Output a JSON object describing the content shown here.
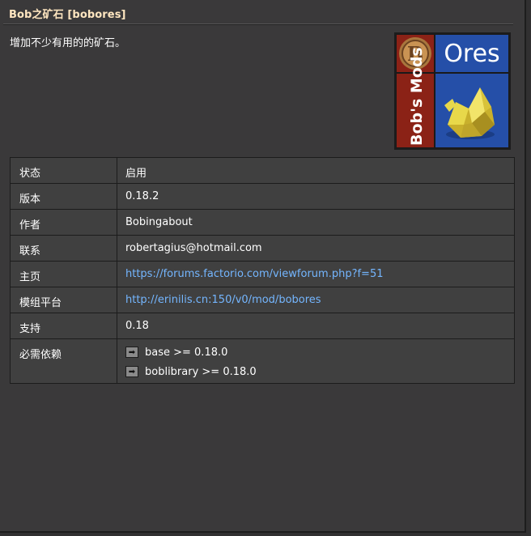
{
  "title": "Bob之矿石 [bobores]",
  "description": "增加不少有用的的矿石。",
  "thumbnail": {
    "ores_text": "Ores",
    "side_text": "Bob's Mods",
    "b_letter": "B",
    "colors": {
      "red": "#8b2216",
      "blue": "#254fa8",
      "gold": "#e5d03b"
    }
  },
  "info": {
    "rows": [
      {
        "label": "状态",
        "value": "启用"
      },
      {
        "label": "版本",
        "value": "0.18.2"
      },
      {
        "label": "作者",
        "value": "Bobingabout"
      },
      {
        "label": "联系",
        "value": "robertagius@hotmail.com"
      },
      {
        "label": "主页",
        "value": "https://forums.factorio.com/viewforum.php?f=51"
      },
      {
        "label": "模组平台",
        "value": "http://erinilis.cn:150/v0/mod/bobores"
      },
      {
        "label": "支持",
        "value": "0.18"
      },
      {
        "label": "必需依赖"
      }
    ],
    "dependencies": [
      "base >= 0.18.0",
      "boblibrary >= 0.18.0"
    ]
  },
  "colors": {
    "link": "#74b6ff",
    "title": "#ffe6c0",
    "panel": "#3a393a"
  }
}
